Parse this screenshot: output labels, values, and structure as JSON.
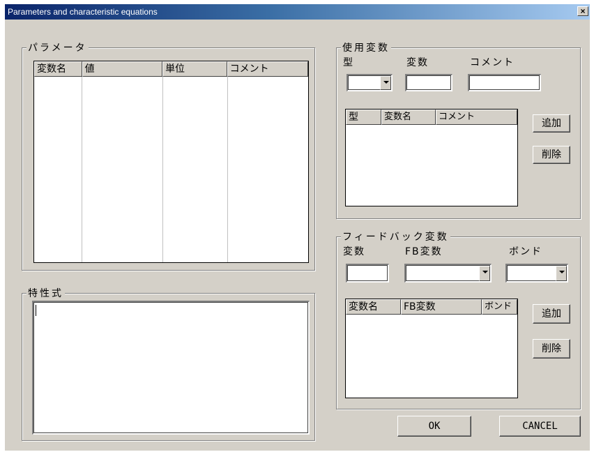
{
  "window": {
    "title": "Parameters and characteristic equations",
    "close_glyph": "×"
  },
  "params_group": {
    "label": "パラメータ",
    "columns": [
      "変数名",
      "値",
      "単位",
      "コメント"
    ]
  },
  "equation_group": {
    "label": "特性式",
    "value": ""
  },
  "used_vars_group": {
    "label": "使用変数",
    "type_label": "型",
    "var_label": "変数",
    "comment_label": "コメント",
    "type_value": "",
    "var_value": "",
    "comment_value": "",
    "columns": [
      "型",
      "変数名",
      "コメント"
    ],
    "add_button": "追加",
    "delete_button": "削除"
  },
  "feedback_group": {
    "label": "フィードバック変数",
    "var_label": "変数",
    "fb_var_label": "FB変数",
    "bond_label": "ボンド",
    "var_value": "",
    "fb_var_value": "",
    "bond_value": "",
    "columns": [
      "変数名",
      "FB変数",
      "ボンド"
    ],
    "add_button": "追加",
    "delete_button": "削除"
  },
  "buttons": {
    "ok": "OK",
    "cancel": "CANCEL"
  }
}
